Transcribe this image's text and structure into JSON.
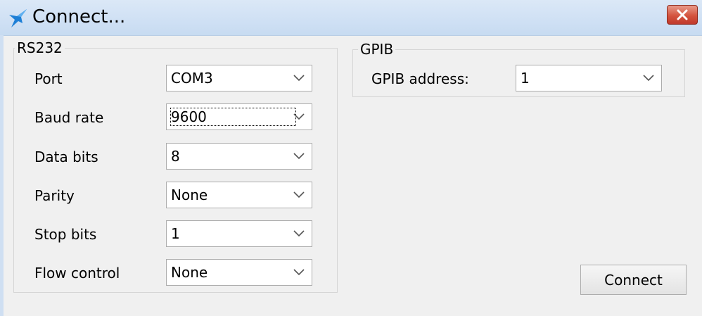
{
  "window": {
    "title": "Connect...",
    "icon": "rocket-icon",
    "close_icon": "close-icon"
  },
  "rs232": {
    "title": "RS232",
    "rows": [
      {
        "label": "Port",
        "value": "COM3"
      },
      {
        "label": "Baud rate",
        "value": "9600"
      },
      {
        "label": "Data bits",
        "value": "8"
      },
      {
        "label": "Parity",
        "value": "None"
      },
      {
        "label": "Stop bits",
        "value": "1"
      },
      {
        "label": "Flow control",
        "value": "None"
      }
    ]
  },
  "gpib": {
    "title": "GPIB",
    "address_label": "GPIB address:",
    "address_value": "1"
  },
  "actions": {
    "connect_label": "Connect"
  },
  "colors": {
    "titlebar": "#cfe0f4",
    "close_button": "#c0392b",
    "dialog_background": "#f0f0f0",
    "icon_blue": "#1d7fd6"
  }
}
